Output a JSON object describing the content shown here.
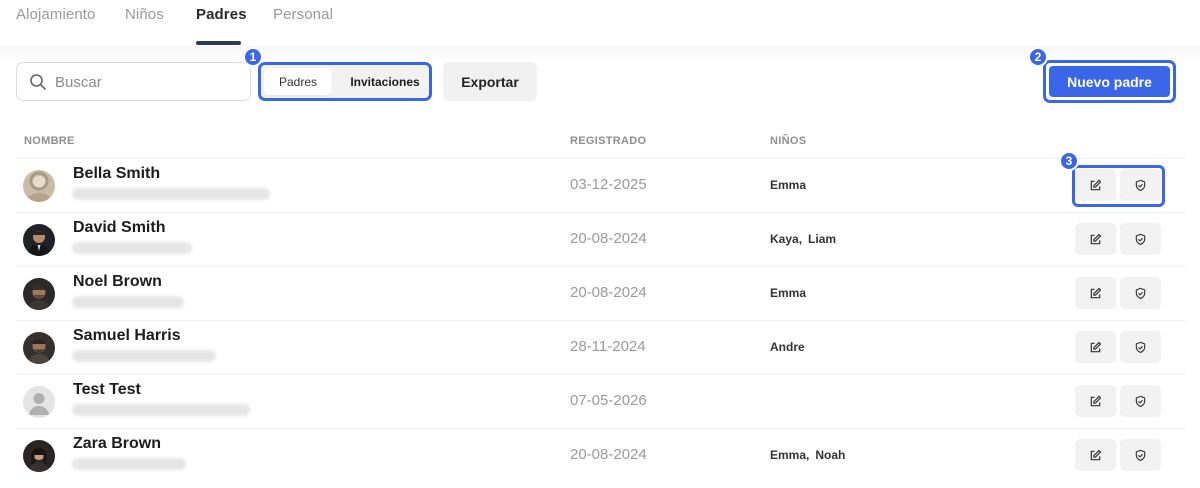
{
  "tabs": [
    {
      "label": "Alojamiento",
      "active": false
    },
    {
      "label": "Niños",
      "active": false
    },
    {
      "label": "Padres",
      "active": true
    },
    {
      "label": "Personal",
      "active": false
    }
  ],
  "toolbar": {
    "search_placeholder": "Buscar",
    "segment_padres": "Padres",
    "segment_invitaciones": "Invitaciones",
    "export_label": "Exportar",
    "new_parent_label": "Nuevo padre"
  },
  "badges": [
    "1",
    "2",
    "3"
  ],
  "table": {
    "headers": {
      "name": "NOMBRE",
      "registered": "REGISTRADO",
      "children": "NIÑOS"
    },
    "rows": [
      {
        "name": "Bella Smith",
        "date": "03-12-2025",
        "children": [
          "Emma"
        ]
      },
      {
        "name": "David Smith",
        "date": "20-08-2024",
        "children": [
          "Kaya",
          "Liam"
        ]
      },
      {
        "name": "Noel Brown",
        "date": "20-08-2024",
        "children": [
          "Emma"
        ]
      },
      {
        "name": "Samuel Harris",
        "date": "28-11-2024",
        "children": [
          "Andre"
        ]
      },
      {
        "name": "Test Test",
        "date": "07-05-2026",
        "children": []
      },
      {
        "name": "Zara Brown",
        "date": "20-08-2024",
        "children": [
          "Emma",
          "Noah"
        ]
      }
    ]
  },
  "icons": {
    "search": "search-icon",
    "edit": "edit-icon",
    "shield": "shield-icon",
    "avatar_placeholder": "user-placeholder-icon"
  },
  "colors": {
    "accent": "#3b66e8",
    "tab_underline": "#2e3a55"
  }
}
